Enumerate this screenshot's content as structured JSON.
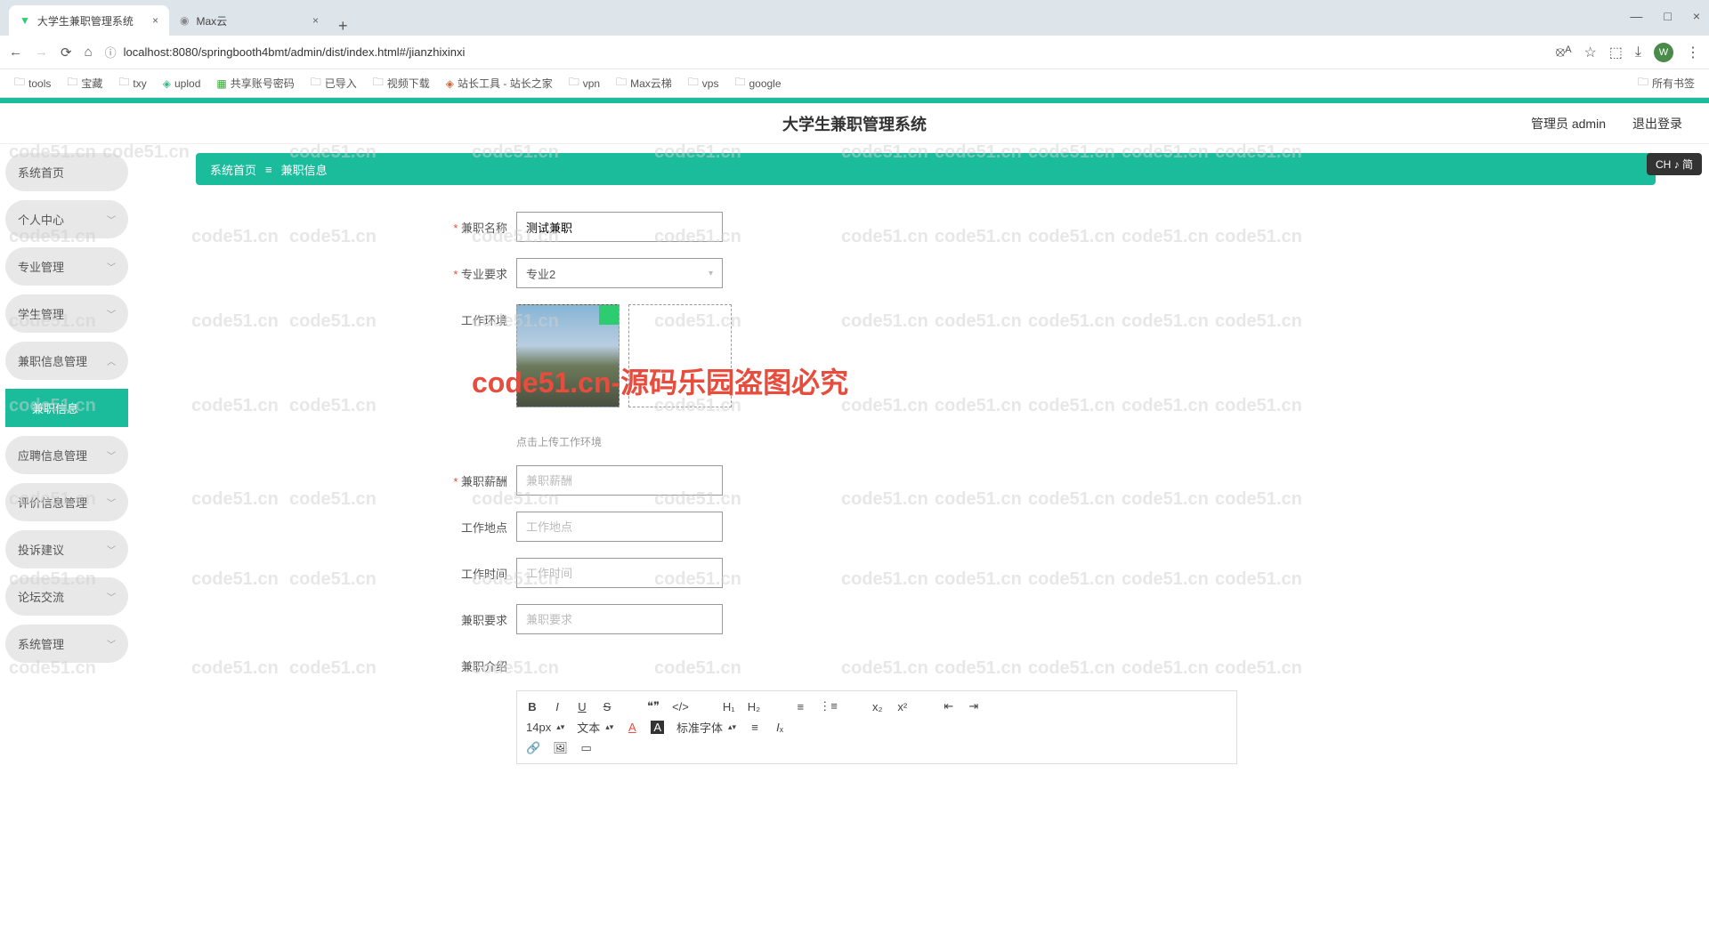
{
  "browser": {
    "tabs": [
      {
        "title": "大学生兼职管理系统",
        "active": true
      },
      {
        "title": "Max云",
        "active": false
      }
    ],
    "url": "localhost:8080/springbooth4bmt/admin/dist/index.html#/jianzhixinxi",
    "bookmarks": [
      "tools",
      "宝藏",
      "txy",
      "uplod",
      "共享账号密码",
      "已导入",
      "视频下载",
      "站长工具 - 站长之家",
      "vpn",
      "Max云梯",
      "vps",
      "google"
    ],
    "bookmarks_right": "所有书签",
    "avatar_letter": "W"
  },
  "app": {
    "title": "大学生兼职管理系统",
    "user_label": "管理员 admin",
    "logout": "退出登录"
  },
  "sidebar": {
    "items": [
      {
        "label": "系统首页",
        "expandable": false
      },
      {
        "label": "个人中心",
        "expandable": true
      },
      {
        "label": "专业管理",
        "expandable": true
      },
      {
        "label": "学生管理",
        "expandable": true
      },
      {
        "label": "兼职信息管理",
        "expandable": true,
        "sub": {
          "label": "兼职信息",
          "active": true
        }
      },
      {
        "label": "应聘信息管理",
        "expandable": true
      },
      {
        "label": "评价信息管理",
        "expandable": true
      },
      {
        "label": "投诉建议",
        "expandable": true
      },
      {
        "label": "论坛交流",
        "expandable": true
      },
      {
        "label": "系统管理",
        "expandable": true
      }
    ]
  },
  "breadcrumb": {
    "home": "系统首页",
    "sep": "≡",
    "current": "兼职信息"
  },
  "ime": "CH ♪ 简",
  "form": {
    "name": {
      "label": "兼职名称",
      "value": "测试兼职"
    },
    "major": {
      "label": "专业要求",
      "value": "专业2"
    },
    "env": {
      "label": "工作环境",
      "hint": "点击上传工作环境"
    },
    "salary": {
      "label": "兼职薪酬",
      "placeholder": "兼职薪酬"
    },
    "location": {
      "label": "工作地点",
      "placeholder": "工作地点"
    },
    "time": {
      "label": "工作时间",
      "placeholder": "工作时间"
    },
    "requirement": {
      "label": "兼职要求",
      "placeholder": "兼职要求"
    },
    "intro": {
      "label": "兼职介绍"
    }
  },
  "editor": {
    "font_size": "14px",
    "text_label": "文本",
    "font_family": "标准字体"
  },
  "watermark": {
    "text": "code51.cn",
    "red": "code51.cn-源码乐园盗图必究"
  }
}
